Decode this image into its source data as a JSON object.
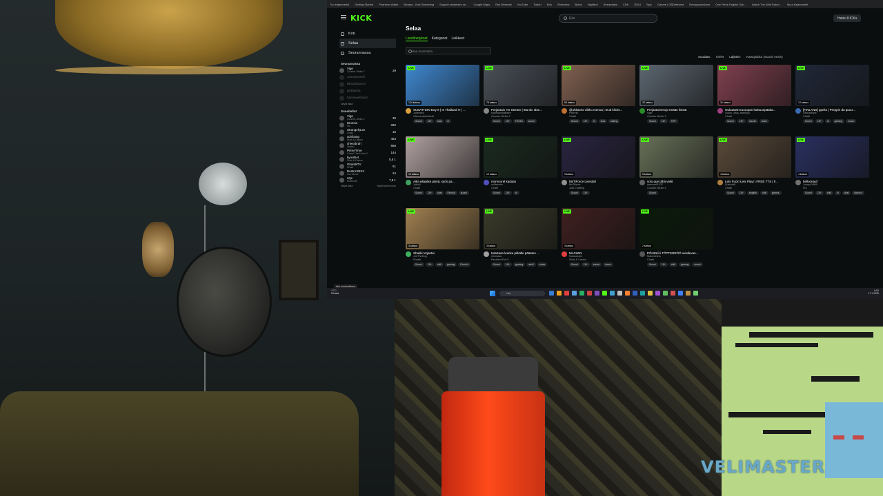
{
  "browser": {
    "bookmarks": [
      "Tuo kirjanmerkit",
      "Getting Started",
      "Phantom Wallet",
      "Browse - Kick Streaming",
      "Soppeli vehkeiden se...",
      "Google Maps",
      "Etsi Webmail",
      "YouTube",
      "Twitch",
      "Kick",
      "Riverview",
      "Botriv",
      "Nightbot",
      "Streamlabs",
      "CDK",
      "IDDU",
      "Spic",
      "Garvee | GBDetected",
      "Revogrowndoom",
      "One Piece English Sub...",
      "Watch The Wild Robot...",
      "Muut kirjanmerkit"
    ],
    "status_url": "kick.com/mrtiforce"
  },
  "kick": {
    "logo": "KICK",
    "search_placeholder": "Etsi",
    "login_label": "Hanki KICKs",
    "nav": [
      {
        "label": "Koti"
      },
      {
        "label": "Selaa"
      },
      {
        "label": "Seurannassa"
      }
    ],
    "following_heading": "Seurannassa",
    "following": [
      {
        "name": "Vige",
        "category": "Counter-Strike 2",
        "viewers": "29",
        "live": true
      },
      {
        "name": "Jamuwetwell",
        "category": "",
        "viewers": "",
        "live": false
      },
      {
        "name": "Blood0SDOO",
        "category": "",
        "viewers": "",
        "live": false
      },
      {
        "name": "pinkfanha",
        "category": "",
        "viewers": "",
        "live": false
      },
      {
        "name": "hannuwetheart",
        "category": "",
        "viewers": "",
        "live": false
      }
    ],
    "following_more": "Näytä lisää",
    "recommended_heading": "Suositellut",
    "recommended": [
      {
        "name": "Vige",
        "category": "Counter-Strike 2",
        "viewers": "30"
      },
      {
        "name": "iDuncia",
        "category": "IRL",
        "viewers": "332"
      },
      {
        "name": "StrangelyLex",
        "category": "Chatti",
        "viewers": "16"
      },
      {
        "name": "achilamp",
        "category": "Slots & Casino",
        "viewers": "454"
      },
      {
        "name": "chessbrah",
        "category": "Shakki",
        "viewers": "565"
      },
      {
        "name": "PrimeTime",
        "category": "Grand Theft Auto V",
        "viewers": "144"
      },
      {
        "name": "kyootbot",
        "category": "Slots & Casino",
        "viewers": "5,5 t."
      },
      {
        "name": "GlossikTV",
        "category": "Chatti",
        "viewers": "51"
      },
      {
        "name": "DestroXBSX",
        "category": "Live Music",
        "viewers": "24"
      },
      {
        "name": "xQc",
        "category": "Minecraft",
        "viewers": "7,8 t."
      }
    ],
    "recommended_more": "Näytä lisää",
    "recommended_less": "Näytä vähemmän",
    "page_title": "Selaa",
    "tabs": [
      "Livelähetykset",
      "Kategoriat",
      "Leikkeet"
    ],
    "filter_placeholder": "Hae tunnisteita",
    "sort_label": "Suodata:",
    "sort_lang": "Kielet",
    "sort_order_label": "Lajittele:",
    "sort_order_value": "Katsojaluku (Suurin ensin)",
    "cards": [
      {
        "title": "SUBATHON Day 6 | In Thailand !!! | ...",
        "user": "Julientha",
        "category": "Ulkona-aktiviteetit",
        "viewers": "134 katsoo",
        "tags": [
          "Suomi",
          "18+",
          "chat",
          "irl"
        ],
        "avatar": "#d8a040"
      },
      {
        "title": "Perjantain YS Stream | Itta Idc Idon...",
        "user": "kultimanraditteen",
        "category": "Counter-Strike 2",
        "viewers": "78 katsoo",
        "tags": [
          "Suomi",
          "18+",
          "FiVelet",
          "suomi"
        ],
        "avatar": "#888"
      },
      {
        "title": "@uhkaOG viikko menoa | teub klicks...",
        "user": "Pelirekt",
        "category": "Chatti",
        "viewers": "50 katsoo",
        "tags": [
          "Suomi",
          "18+",
          "irl",
          "chat",
          "talking"
        ],
        "avatar": "#c07030"
      },
      {
        "title": "Perjantaivenojo tmään ilsistä",
        "user": "Vige",
        "category": "Counter-Strike 2",
        "viewers": "32 katsoo",
        "tags": [
          "Suomi",
          "18+",
          "KTP"
        ],
        "avatar": "#2a8a2a"
      },
      {
        "title": "Oulu2026 Euroopan kulttuuripääka...",
        "user": "Oulun_Asia_teamyys",
        "category": "Chatti",
        "viewers": "31 katsoo",
        "tags": [
          "Suomi",
          "18+",
          "ukunis",
          "actor"
        ],
        "avatar": "#a04080"
      },
      {
        "title": "[FINLAND] ppeks | Preppin da tpuzz...",
        "user": "OfficialMyst",
        "category": "Chatti",
        "viewers": "12 katsoo",
        "tags": [
          "Suomi",
          "18+",
          "irl",
          "gaming",
          "music"
        ],
        "avatar": "#3a6ab0"
      },
      {
        "title": "Aika eilaalise päivä, syön pa...",
        "user": "JukoN",
        "category": "Chatti",
        "viewers": "10 katsoo",
        "tags": [
          "Suomi",
          "18+",
          "chat",
          "Finnish",
          "suomi"
        ],
        "avatar": "#40a060"
      },
      {
        "title": "morenorel kadaas",
        "user": "veilisextor",
        "category": "Chatti",
        "viewers": "10 katsoo",
        "tags": [
          "Suomi",
          "18+",
          "irl"
        ],
        "avatar": "#5050c0"
      },
      {
        "title": "MsTiForce Livestall",
        "user": "MsTiforce",
        "category": "Just Chatting",
        "viewers": "9 katsoo",
        "tags": [
          "Suomi",
          "18+"
        ],
        "avatar": "#909090"
      },
      {
        "title": "solo que tähä veilit",
        "user": "aorenreli1337",
        "category": "Counter-Strike 2",
        "viewers": "5 katsoo",
        "tags": [
          "Suomi"
        ],
        "avatar": "#606060"
      },
      {
        "title": "Lets Fuck! Lets Play! | FREE TTS | F...",
        "user": "Sukurkt8",
        "category": "Chatti",
        "viewers": "4 katsoo",
        "tags": [
          "Suomi",
          "18+",
          "english",
          "chill",
          "games"
        ],
        "avatar": "#b08040"
      },
      {
        "title": "helloonauf",
        "user": "Jumpcl1688",
        "category": "IRL",
        "viewers": "4 katsoo",
        "tags": [
          "Suomi",
          "18+",
          "chill",
          "irl",
          "chat",
          "discord"
        ],
        "avatar": "#707070"
      },
      {
        "title": "Shakki torjantai",
        "user": "JoeTheDog",
        "category": "Shakki",
        "viewers": "3 katsoo",
        "tags": [
          "Suomi",
          "18+",
          "chill",
          "gaming",
          "Finnish"
        ],
        "avatar": "#40b060"
      },
      {
        "title": "Katotaan kuinka pitkälle päästen ...",
        "user": "mirosasu",
        "category": "Resident Evil 5",
        "viewers": "3 katsoo",
        "tags": [
          "Suomi",
          "18+",
          "gaming",
          "ads2",
          "eniss"
        ],
        "avatar": "#a0a0a0"
      },
      {
        "title": "MAXWIN",
        "user": "Nousutcom",
        "category": "Slots & Casino",
        "viewers": "3 katsoo",
        "tags": [
          "Suomi",
          "18+",
          "suomi",
          "demo"
        ],
        "avatar": "#e04040"
      },
      {
        "title": "PÖHINÄÄ TÖTTERRÖÖ viesllevan...",
        "user": "Makrotelina",
        "category": "Chatti",
        "viewers": "2 katsoo",
        "tags": [
          "Suomi",
          "18+",
          "chill",
          "gaming",
          "suomi"
        ],
        "avatar": "#555"
      }
    ],
    "live_label": "LIVE"
  },
  "taskbar": {
    "weather_temp": "+7°C",
    "weather_desc": "Pilvistä",
    "search_label": "Hae",
    "time": "6:52",
    "date": "17.1.2025",
    "icon_colors": [
      "#3a7bd5",
      "#f0a020",
      "#e04040",
      "#5aa0e0",
      "#2ab060",
      "#d04040",
      "#8050c0",
      "#53fc18",
      "#40a0d0",
      "#c0c0c0",
      "#ff8030",
      "#3060c0",
      "#20a0a0",
      "#e0c040",
      "#a050d0",
      "#60c060",
      "#d05050",
      "#4080ff",
      "#c09040",
      "#70d070"
    ]
  },
  "overlay": {
    "brand": "VELIMASTER"
  }
}
